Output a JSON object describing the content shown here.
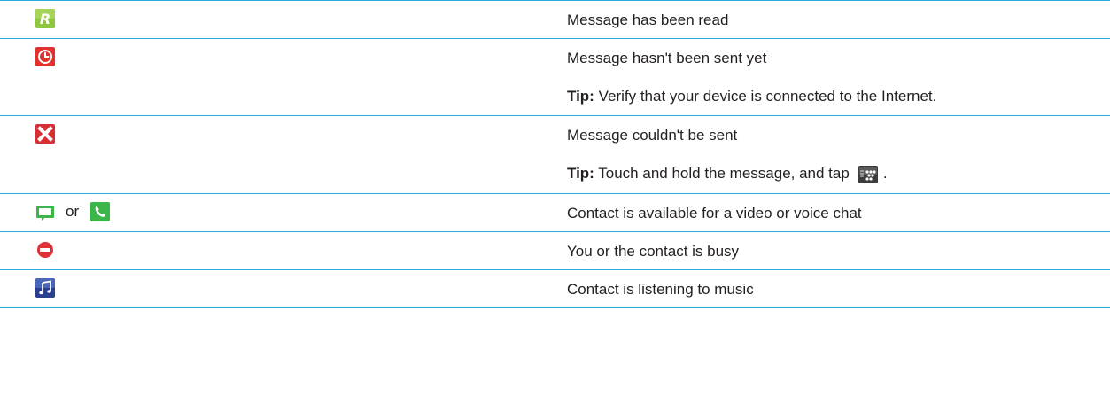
{
  "rows": [
    {
      "icon_names": [
        "read-r-icon"
      ],
      "description": "Message has been read"
    },
    {
      "icon_names": [
        "clock-icon"
      ],
      "description": "Message hasn't been sent yet",
      "tip_label": "Tip:",
      "tip_text": " Verify that your device is connected to the Internet."
    },
    {
      "icon_names": [
        "error-x-icon"
      ],
      "description": "Message couldn't be sent",
      "tip_label": "Tip:",
      "tip_text": " Touch and hold the message, and tap",
      "tip_icon": "bbm-resend-icon",
      "tip_end": "."
    },
    {
      "icon_names": [
        "video-chat-icon",
        "voice-chat-icon"
      ],
      "separator": "or",
      "description": "Contact is available for a video or voice chat"
    },
    {
      "icon_names": [
        "busy-icon"
      ],
      "description": "You or the contact is busy"
    },
    {
      "icon_names": [
        "music-note-icon"
      ],
      "description": "Contact is listening to music"
    }
  ],
  "colors": {
    "rule": "#2aa9db",
    "read_green": "#8dc63f",
    "clock_red": "#e0332f",
    "error_red": "#d62f35",
    "chat_green": "#3cb54a",
    "busy_red": "#e03236",
    "music_blue": "#2c3f8f"
  }
}
